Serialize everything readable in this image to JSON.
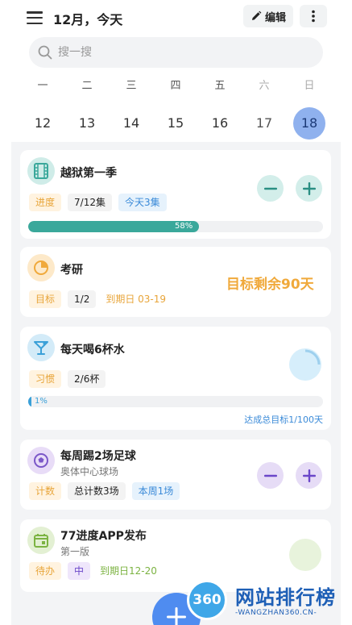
{
  "header": {
    "title": "12月，今天",
    "edit_label": "编辑"
  },
  "search": {
    "placeholder": "搜一搜"
  },
  "week": {
    "days": [
      {
        "weekday": "一",
        "date": "12"
      },
      {
        "weekday": "二",
        "date": "13"
      },
      {
        "weekday": "三",
        "date": "14"
      },
      {
        "weekday": "四",
        "date": "15"
      },
      {
        "weekday": "五",
        "date": "16"
      },
      {
        "weekday": "六",
        "date": "17"
      },
      {
        "weekday": "日",
        "date": "18"
      }
    ],
    "selected_date": "18"
  },
  "cards": [
    {
      "title": "越狱第一季",
      "tags": [
        "进度",
        "7/12集",
        "今天3集"
      ],
      "progress": 0.58,
      "progress_label": "58%",
      "icon": "film-icon",
      "color": "#3aa89b"
    },
    {
      "title": "考研",
      "tags": [
        "目标",
        "1/2",
        "到期日 03-19"
      ],
      "highlight": "目标剩余90天",
      "icon": "pie-chart-icon",
      "color": "#f0a93b"
    },
    {
      "title": "每天喝6杯水",
      "tags": [
        "习惯",
        "2/6杯"
      ],
      "progress": 0.01,
      "progress_label": "1%",
      "footer": "达成总目标1/100天",
      "icon": "cocktail-icon",
      "color": "#3aa0d8"
    },
    {
      "title": "每周踢2场足球",
      "subtitle": "奥体中心球场",
      "tags": [
        "计数",
        "总计数3场",
        "本周1场"
      ],
      "icon": "soccer-ball-icon",
      "color": "#7b57c8"
    },
    {
      "title": "77进度APP发布",
      "subtitle": "第一版",
      "tags": [
        "待办",
        "中",
        "到期日12-20"
      ],
      "icon": "calendar-icon",
      "color": "#7cb342"
    }
  ],
  "watermark": {
    "logo_text": "360",
    "title": "网站排行榜",
    "subtitle": "-WANGZHAN360.CN-"
  }
}
